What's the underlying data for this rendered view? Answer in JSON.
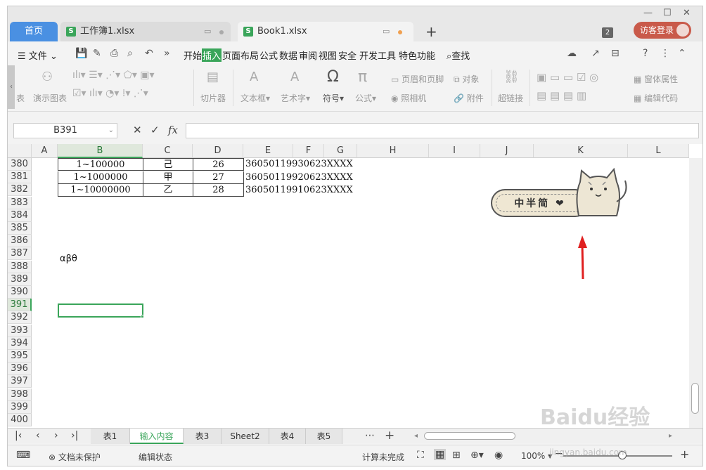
{
  "window": {
    "controls": [
      "—",
      "☐",
      "✕"
    ]
  },
  "tabs": {
    "home": "首页",
    "doc1": "工作簿1.xlsx",
    "doc2": "Book1.xlsx",
    "doc2_icon": "S",
    "doc1_icon": "S",
    "badge": "2",
    "login": "访客登录"
  },
  "menu": {
    "file": "文件",
    "items": [
      "开始",
      "插入",
      "页面布局",
      "公式",
      "数据",
      "审阅",
      "视图",
      "安全",
      "开发工具",
      "特色功能"
    ],
    "active": "插入",
    "search": "查找"
  },
  "ribbon": {
    "left_cut": "表",
    "demo_chart": "演示图表",
    "slicer": "切片器",
    "textbox": "文本框",
    "wordart": "艺术字",
    "symbol": "符号",
    "formula": "公式",
    "header_footer": "页眉和页脚",
    "object": "对象",
    "camera": "照相机",
    "attachment": "附件",
    "hyperlink": "超链接",
    "form_props": "窗体属性",
    "edit_code": "编辑代码"
  },
  "formula_bar": {
    "name_box": "B391",
    "cancel": "✕",
    "confirm": "✓",
    "fx": "fx",
    "value": ""
  },
  "grid": {
    "columns": [
      "A",
      "B",
      "C",
      "D",
      "E",
      "F",
      "G",
      "H",
      "I",
      "J",
      "K",
      "L"
    ],
    "selected_column": "B",
    "rows": [
      "380",
      "381",
      "382",
      "383",
      "384",
      "385",
      "386",
      "387",
      "388",
      "389",
      "390",
      "391",
      "392",
      "393",
      "394",
      "395",
      "396",
      "397",
      "398",
      "399",
      "400"
    ],
    "selected_row": "391",
    "table": [
      {
        "b": "1~100000",
        "c": "己",
        "d": "26",
        "e": "36050119930623XXXX"
      },
      {
        "b": "1~1000000",
        "c": "甲",
        "d": "27",
        "e": "36050119920623XXXX"
      },
      {
        "b": "1~10000000",
        "c": "乙",
        "d": "28",
        "e": "36050119910623XXXX"
      }
    ],
    "greek": "αβθ",
    "sticker_text": "中半简 ❤"
  },
  "sheets": {
    "tabs": [
      "表1",
      "输入内容",
      "表3",
      "Sheet2",
      "表4",
      "表5"
    ],
    "active": "输入内容",
    "more": "⋯",
    "add": "+"
  },
  "status": {
    "protect": "文档未保护",
    "edit_state": "编辑状态",
    "calc": "计算未完成",
    "zoom": "100%"
  },
  "watermark": {
    "main": "Baidu经验",
    "sub": "jingyan.baidu.com"
  },
  "colors": {
    "accent_green": "#3aa55a",
    "home_tab": "#4a90e2",
    "login": "#c95a4a",
    "arrow": "#e02020"
  }
}
